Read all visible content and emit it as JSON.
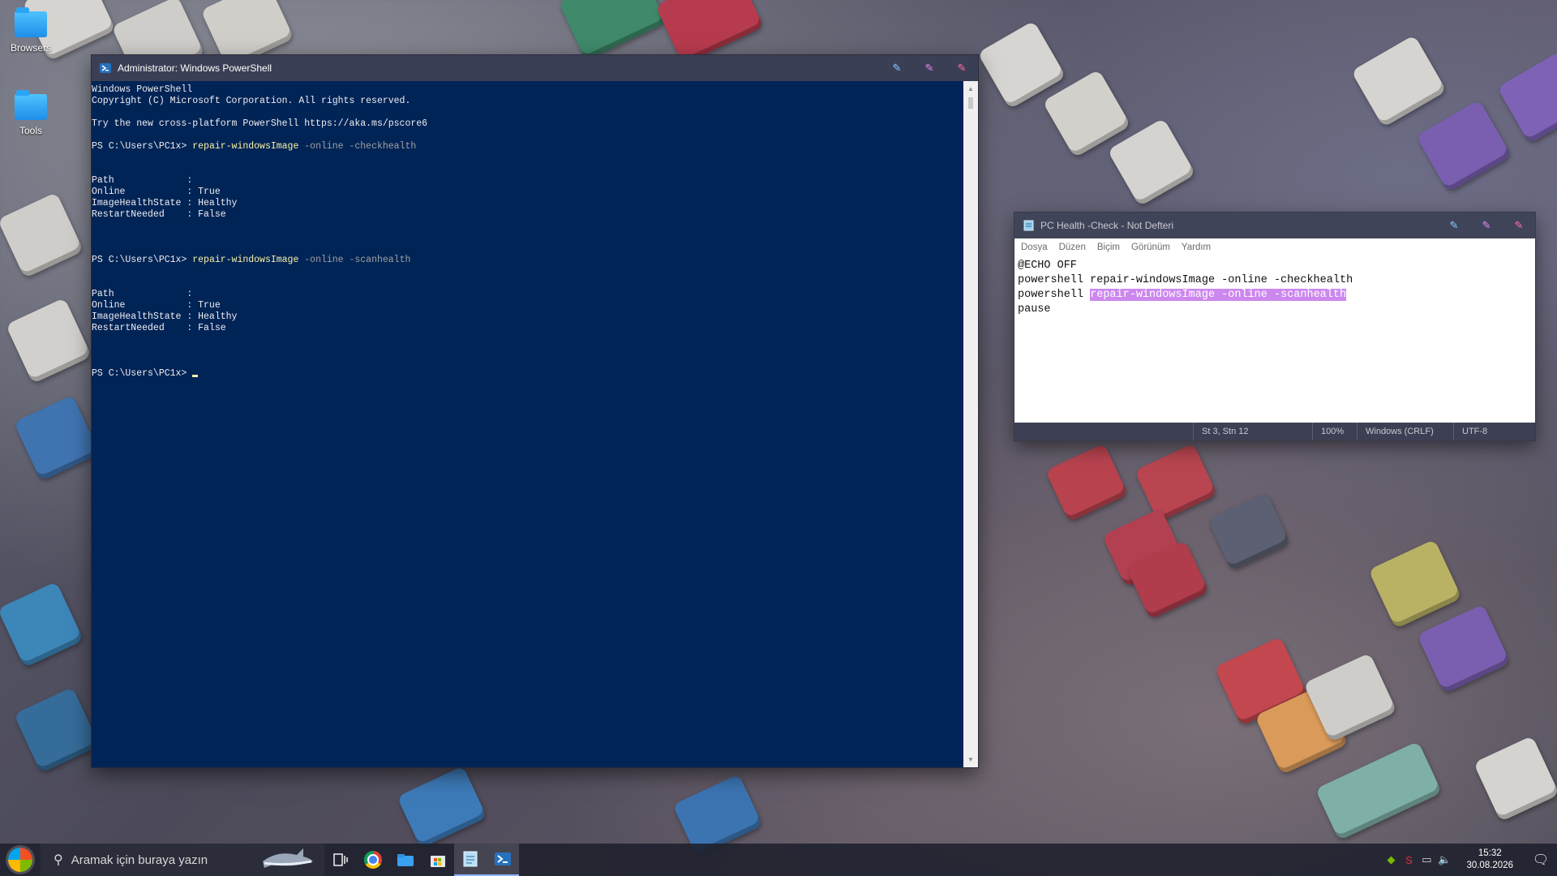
{
  "desktop": {
    "icons": [
      {
        "label": "Browsers"
      },
      {
        "label": "Tools"
      }
    ]
  },
  "powershell": {
    "title": "Administrator: Windows PowerShell",
    "lines": [
      {
        "text": "Windows PowerShell"
      },
      {
        "text": "Copyright (C) Microsoft Corporation. All rights reserved."
      },
      {
        "text": ""
      },
      {
        "text": "Try the new cross-platform PowerShell https://aka.ms/pscore6"
      },
      {
        "text": ""
      },
      {
        "prompt": "PS C:\\Users\\PC1x> ",
        "cmd": "repair-windowsImage",
        "args": " -online -checkhealth"
      },
      {
        "text": ""
      },
      {
        "text": ""
      },
      {
        "text": "Path             :"
      },
      {
        "text": "Online           : True"
      },
      {
        "text": "ImageHealthState : Healthy"
      },
      {
        "text": "RestartNeeded    : False"
      },
      {
        "text": ""
      },
      {
        "text": ""
      },
      {
        "text": ""
      },
      {
        "prompt": "PS C:\\Users\\PC1x> ",
        "cmd": "repair-windowsImage",
        "args": " -online -scanhealth"
      },
      {
        "text": ""
      },
      {
        "text": ""
      },
      {
        "text": "Path             :"
      },
      {
        "text": "Online           : True"
      },
      {
        "text": "ImageHealthState : Healthy"
      },
      {
        "text": "RestartNeeded    : False"
      },
      {
        "text": ""
      },
      {
        "text": ""
      },
      {
        "text": ""
      },
      {
        "prompt": "PS C:\\Users\\PC1x> ",
        "cursor": true
      }
    ]
  },
  "notepad": {
    "title": "PC Health -Check - Not Defteri",
    "menu": [
      "Dosya",
      "Düzen",
      "Biçim",
      "Görünüm",
      "Yardım"
    ],
    "lines": [
      {
        "text": "@ECHO OFF"
      },
      {
        "text": "powershell repair-windowsImage -online -checkhealth"
      },
      {
        "text": "powershell ",
        "selected": "repair-windowsImage -online -scanhealth"
      },
      {
        "text": "pause"
      }
    ],
    "status": {
      "position": "St 3, Stn 12",
      "zoom": "100%",
      "line_ending": "Windows (CRLF)",
      "encoding": "UTF-8"
    }
  },
  "taskbar": {
    "search_placeholder": "Aramak için buraya yazın",
    "time": "15:32",
    "date": "30.08.2026"
  },
  "colors": {
    "ps_background": "#012456",
    "ps_command": "#f9f1a5",
    "selection": "#cc88ee",
    "titlebar_button_minimize": "#7ecbff",
    "titlebar_button_maximize": "#e08af0",
    "titlebar_button_close": "#ff6fa5"
  }
}
